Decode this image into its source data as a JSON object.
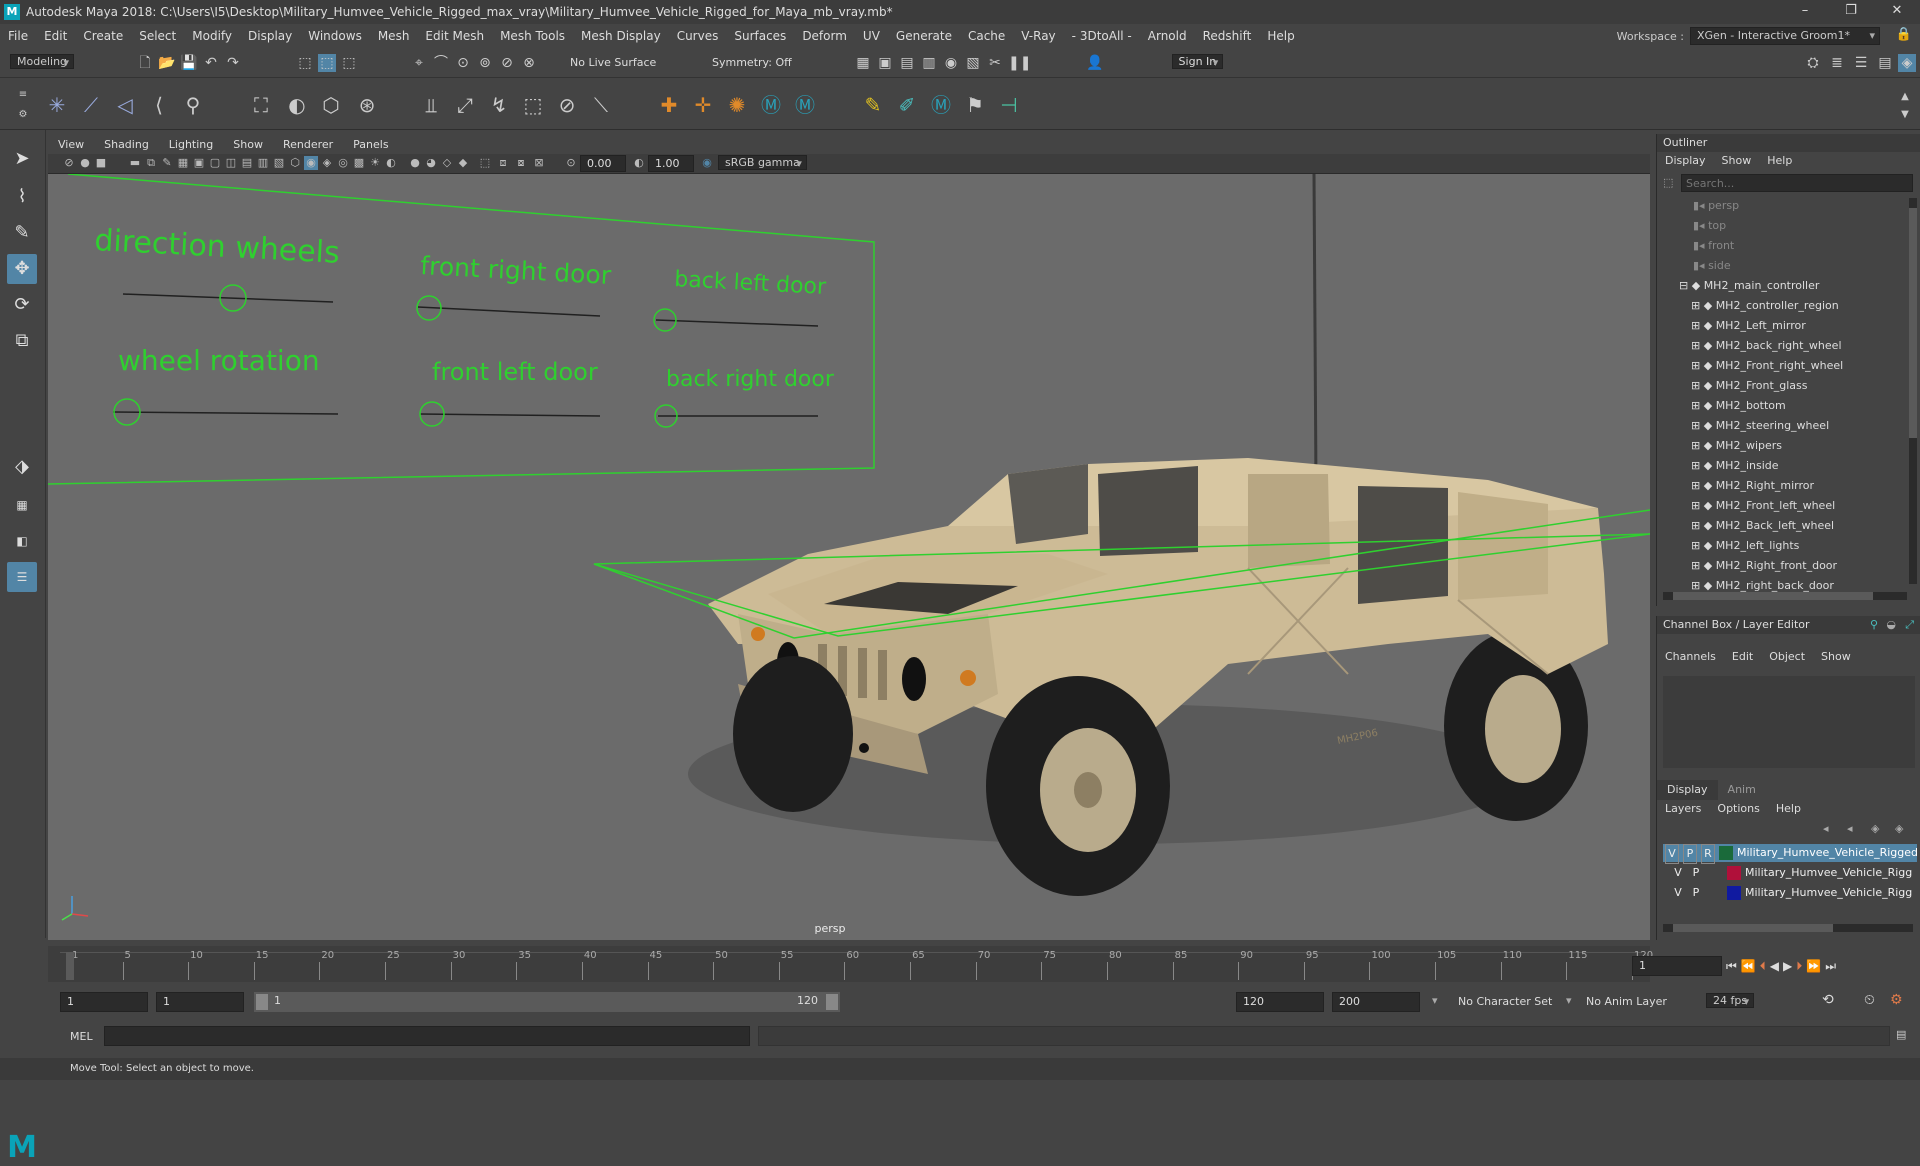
{
  "window": {
    "title": "Autodesk Maya 2018: C:\\Users\\I5\\Desktop\\Military_Humvee_Vehicle_Rigged_max_vray\\Military_Humvee_Vehicle_Rigged_for_Maya_mb_vray.mb*",
    "minimize": "–",
    "restore": "❐",
    "close": "✕"
  },
  "menubar": {
    "items": [
      "File",
      "Edit",
      "Create",
      "Select",
      "Modify",
      "Display",
      "Windows",
      "Mesh",
      "Edit Mesh",
      "Mesh Tools",
      "Mesh Display",
      "Curves",
      "Surfaces",
      "Deform",
      "UV",
      "Generate",
      "Cache",
      "V-Ray",
      "- 3DtoAll -",
      "Arnold",
      "Redshift",
      "Help"
    ],
    "workspace_label": "Workspace :",
    "workspace_value": "XGen - Interactive Groom1*"
  },
  "statusline": {
    "mode": "Modeling",
    "live_surface": "No Live Surface",
    "symmetry": "Symmetry: Off",
    "sign_in": "Sign In"
  },
  "viewport": {
    "menu": [
      "View",
      "Shading",
      "Lighting",
      "Show",
      "Renderer",
      "Panels"
    ],
    "exposure": "0.00",
    "gamma": "1.00",
    "colorspace": "sRGB gamma",
    "camera_label": "persp",
    "controls": {
      "direction_wheels": "direction wheels",
      "wheel_rotation": "wheel rotation",
      "front_right_door": "front right door",
      "front_left_door": "front left door",
      "back_left_door": "back left door",
      "back_right_door": "back right door"
    },
    "vehicle_plate": "MH2P06"
  },
  "outliner": {
    "title": "Outliner",
    "menu": [
      "Display",
      "Show",
      "Help"
    ],
    "search_placeholder": "Search...",
    "cameras": [
      "persp",
      "top",
      "front",
      "side"
    ],
    "root": "MH2_main_controller",
    "children": [
      "MH2_controller_region",
      "MH2_Left_mirror",
      "MH2_back_right_wheel",
      "MH2_Front_right_wheel",
      "MH2_Front_glass",
      "MH2_bottom",
      "MH2_steering_wheel",
      "MH2_wipers",
      "MH2_inside",
      "MH2_Right_mirror",
      "MH2_Front_left_wheel",
      "MH2_Back_left_wheel",
      "MH2_left_lights",
      "MH2_Right_front_door",
      "MH2_right_back_door"
    ]
  },
  "channelbox": {
    "title": "Channel Box / Layer Editor",
    "menu": [
      "Channels",
      "Edit",
      "Object",
      "Show"
    ]
  },
  "layereditor": {
    "tabs": [
      "Display",
      "Anim"
    ],
    "menu": [
      "Layers",
      "Options",
      "Help"
    ],
    "layers": [
      {
        "v": "V",
        "p": "P",
        "r": "R",
        "name": "Military_Humvee_Vehicle_Rigged",
        "color": "#1a6a3a"
      },
      {
        "v": "V",
        "p": "P",
        "r": "",
        "name": "Military_Humvee_Vehicle_Rigg",
        "color": "#b0103a"
      },
      {
        "v": "V",
        "p": "P",
        "r": "",
        "name": "Military_Humvee_Vehicle_Rigg",
        "color": "#101aa0"
      }
    ]
  },
  "timeline": {
    "ticks": [
      "1",
      "5",
      "10",
      "15",
      "20",
      "25",
      "30",
      "35",
      "40",
      "45",
      "50",
      "55",
      "60",
      "65",
      "70",
      "75",
      "80",
      "85",
      "90",
      "95",
      "100",
      "105",
      "110",
      "115",
      "120"
    ],
    "current_frame": "1"
  },
  "range": {
    "start": "1",
    "playback_start": "1",
    "slider_start": "1",
    "slider_end": "120",
    "playback_end": "120",
    "end": "200",
    "character_set": "No Character Set",
    "anim_layer": "No Anim Layer",
    "fps": "24 fps"
  },
  "cmdline": {
    "label": "MEL"
  },
  "helpline": {
    "text": "Move Tool: Select an object to move."
  },
  "colors": {
    "accent": "#5285a6",
    "rig_green": "#2fd02f",
    "humvee_tan": "#cdbb96"
  }
}
